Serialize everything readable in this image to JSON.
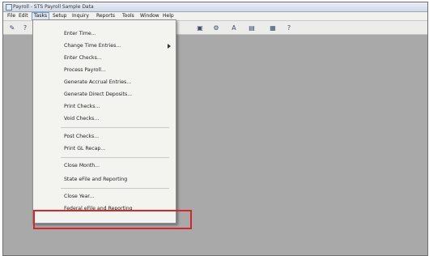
{
  "window": {
    "title": "Payroll - STS Payroll Sample Data"
  },
  "menubar": {
    "items": [
      "File",
      "Edit",
      "Tasks",
      "Setup",
      "Inquiry",
      "Reports",
      "Tools",
      "Window",
      "Help"
    ],
    "active": "Tasks"
  },
  "toolbar": {
    "icons": [
      "edit-icon",
      "help-icon",
      "paste-icon",
      "gear-icon",
      "text-icon",
      "document-icon",
      "calculator-icon",
      "question-icon"
    ]
  },
  "tasks_menu": {
    "items": [
      "Enter Time...",
      "Change Time Entries...",
      "Enter Checks...",
      "Process Payroll...",
      "Generate Accrual Entries...",
      "Generate Direct Deposits...",
      "Print Checks...",
      "Void Checks...",
      "Post Checks...",
      "Print GL Recap...",
      "Close Month...",
      "State eFile and Reporting",
      "Close Year...",
      "Federal eFile and Reporting"
    ],
    "highlighted_item": "Federal eFile and Reporting",
    "highlight_color": "#d3272b"
  }
}
